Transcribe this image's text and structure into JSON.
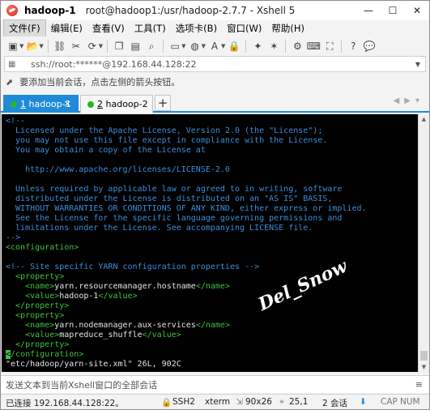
{
  "window": {
    "host": "hadoop-1",
    "path_title": "root@hadoop1:/usr/hadoop-2.7.7 - Xshell 5",
    "controls": {
      "minimize": "—",
      "maximize": "☐",
      "close": "✕"
    }
  },
  "menu": [
    {
      "label": "文件(F)"
    },
    {
      "label": "编辑(E)"
    },
    {
      "label": "查看(V)"
    },
    {
      "label": "工具(T)"
    },
    {
      "label": "选项卡(B)"
    },
    {
      "label": "窗口(W)"
    },
    {
      "label": "帮助(H)"
    }
  ],
  "address": {
    "text": "ssh://root:******@192.168.44.128:22"
  },
  "hint": {
    "text": "要添加当前会话，点击左侧的箭头按钮。"
  },
  "tabs": [
    {
      "num": "1",
      "label": "hadoop-1",
      "active": true
    },
    {
      "num": "2",
      "label": "hadoop-2",
      "active": false
    }
  ],
  "terminal": {
    "lines": [
      {
        "text": "<!--",
        "type": "comment"
      },
      {
        "text": "  Licensed under the Apache License, Version 2.0 (the \"License\");",
        "type": "comment"
      },
      {
        "text": "  you may not use this file except in compliance with the License.",
        "type": "comment"
      },
      {
        "text": "  You may obtain a copy of the License at",
        "type": "comment"
      },
      {
        "text": "",
        "type": "comment"
      },
      {
        "text": "    http://www.apache.org/licenses/LICENSE-2.0",
        "type": "comment"
      },
      {
        "text": "",
        "type": "comment"
      },
      {
        "text": "  Unless required by applicable law or agreed to in writing, software",
        "type": "comment"
      },
      {
        "text": "  distributed under the License is distributed on an \"AS IS\" BASIS,",
        "type": "comment"
      },
      {
        "text": "  WITHOUT WARRANTIES OR CONDITIONS OF ANY KIND, either express or implied.",
        "type": "comment"
      },
      {
        "text": "  See the License for the specific language governing permissions and",
        "type": "comment"
      },
      {
        "text": "  limitations under the License. See accompanying LICENSE file.",
        "type": "comment"
      },
      {
        "text": "-->",
        "type": "comment"
      },
      {
        "text": "<configuration>",
        "type": "tag"
      },
      {
        "text": "",
        "type": "text"
      },
      {
        "text": "<!-- Site specific YARN configuration properties -->",
        "type": "comment"
      },
      {
        "text": "  <property>",
        "type": "tag"
      },
      {
        "text": "    <name>yarn.resourcemanager.hostname</name>",
        "type": "mixed"
      },
      {
        "text": "    <value>hadoop-1</value>",
        "type": "mixed"
      },
      {
        "text": "  </property>",
        "type": "tag"
      },
      {
        "text": "  <property>",
        "type": "tag"
      },
      {
        "text": "    <name>yarn.nodemanager.aux-services</name>",
        "type": "mixed"
      },
      {
        "text": "    <value>mapreduce_shuffle</value>",
        "type": "mixed"
      },
      {
        "text": "  </property>",
        "type": "tag"
      },
      {
        "text": "</configuration>",
        "type": "cursorline"
      },
      {
        "text": "\"etc/hadoop/yarn-site.xml\" 26L, 902C",
        "type": "text"
      }
    ],
    "watermark": "Del_Snow"
  },
  "sendbar": {
    "text": "发送文本到当前Xshell窗口的全部会话"
  },
  "status": {
    "connection": "已连接 192.168.44.128:22。",
    "protocol": "SSH2",
    "terminal": "xterm",
    "size": "90x26",
    "position": "25,1",
    "sessions": "2 会话",
    "caps": "CAP",
    "num": "NUM"
  },
  "colors": {
    "accent": "#1f8bd8",
    "comment": "#3c8edb",
    "tag": "#3ec23e",
    "connected_dot": "#2bb52b"
  }
}
